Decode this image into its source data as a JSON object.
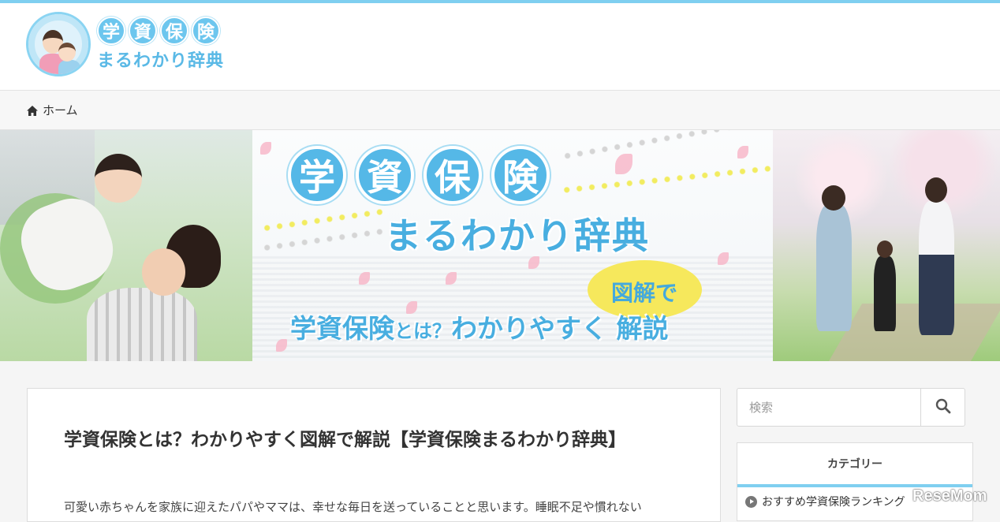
{
  "site": {
    "logo_row1": [
      "学",
      "資",
      "保",
      "険"
    ],
    "logo_row2": "まるわかり辞典",
    "accent_color": "#7fcff0"
  },
  "breadcrumb": {
    "icon": "home-icon",
    "label": "ホーム"
  },
  "hero": {
    "title_chars": [
      "学",
      "資",
      "保",
      "険"
    ],
    "subtitle": "まるわかり辞典",
    "bubble": "図解で",
    "tagline_a": "学資保険",
    "tagline_b": "とは？",
    "tagline_c": "わかりやすく 解説"
  },
  "article": {
    "title": "学資保険とは？わかりやすく図解で解説【学資保険まるわかり辞典】",
    "body": "可愛い赤ちゃんを家族に迎えたパパやママは、幸せな毎日を送っていることと思います。睡眠不足や慣れない"
  },
  "search": {
    "placeholder": "検索",
    "button_icon": "search-icon"
  },
  "sidebar": {
    "category_title": "カテゴリー",
    "items": [
      {
        "label": "おすすめ学資保険ランキング"
      }
    ]
  },
  "watermark": "ReseMom"
}
